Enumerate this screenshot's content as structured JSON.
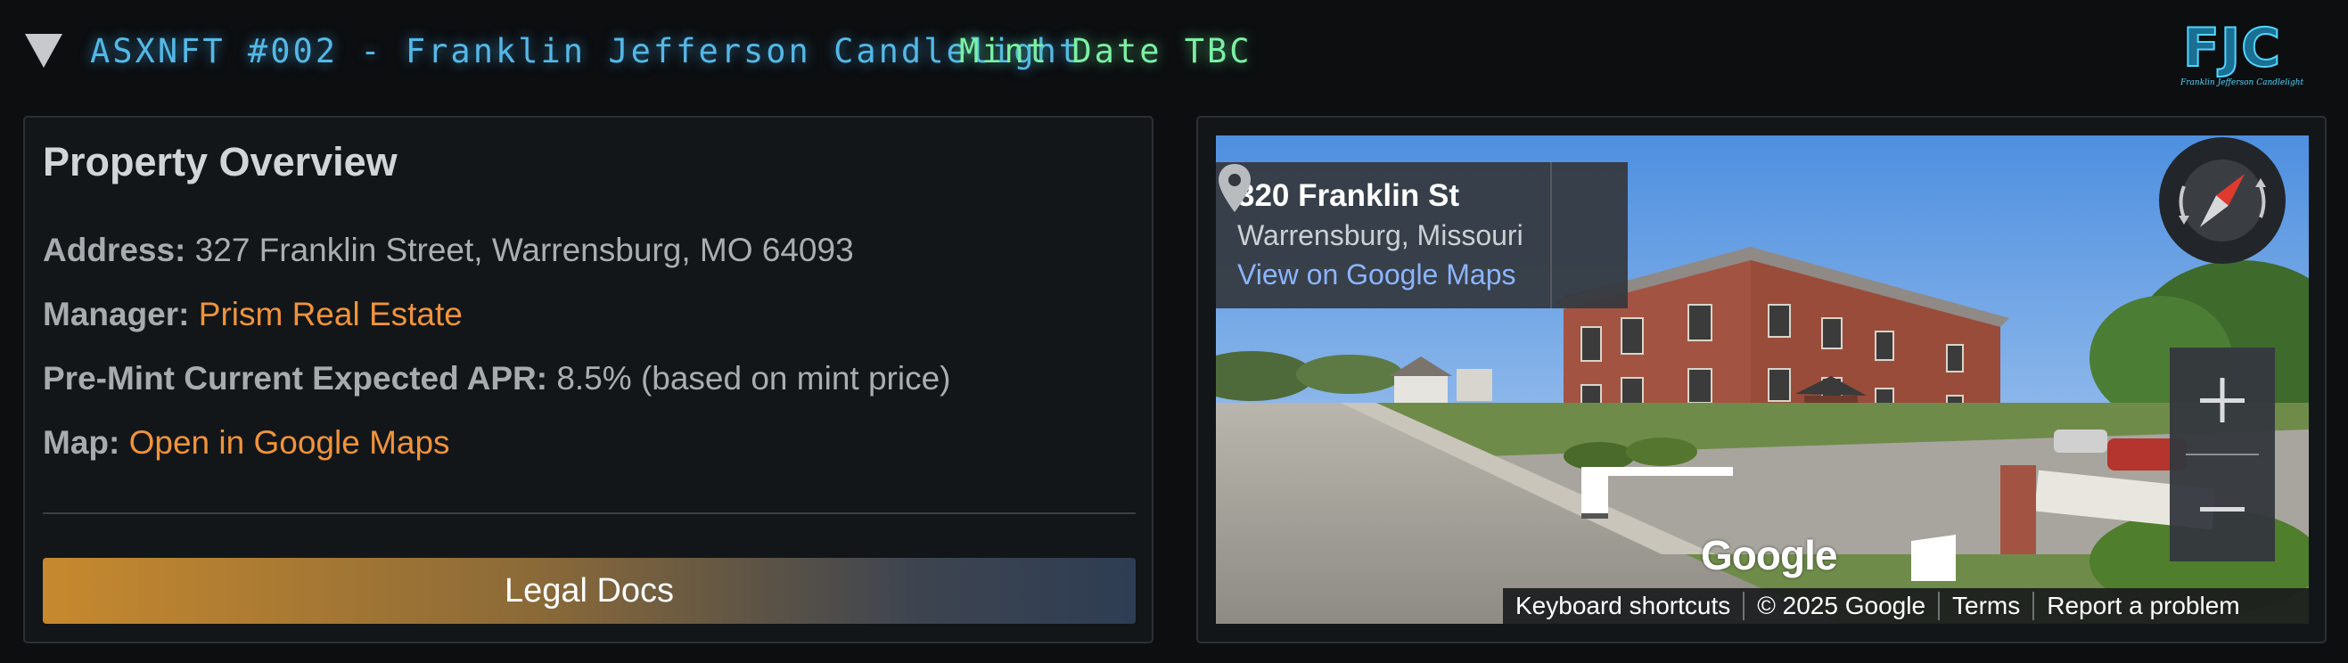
{
  "header": {
    "title": "ASXNFT #002 - Franklin Jefferson Candlelight",
    "mint_date": "Mint Date TBC",
    "logo_text": "FJC",
    "logo_subtitle": "Franklin Jefferson Candlelight"
  },
  "overview": {
    "title": "Property Overview",
    "address_label": "Address:",
    "address_value": "327 Franklin Street, Warrensburg, MO 64093",
    "manager_label": "Manager:",
    "manager_value": "Prism Real Estate",
    "apr_label": "Pre-Mint Current Expected APR:",
    "apr_value": "8.5% (based on mint price)",
    "map_label": "Map:",
    "map_link": "Open in Google Maps",
    "legal_button": "Legal Docs"
  },
  "map": {
    "street": "320 Franklin St",
    "city": "Warrensburg, Missouri",
    "view_link": "View on Google Maps",
    "google_logo": "Google",
    "footer": {
      "shortcuts": "Keyboard shortcuts",
      "copyright": "© 2025 Google",
      "terms": "Terms",
      "report": "Report a problem"
    }
  },
  "icons": [
    "collapse-triangle-icon",
    "map-pin-icon",
    "compass-icon",
    "zoom-in-icon",
    "zoom-out-icon"
  ],
  "colors": {
    "title_glow": "#54b8e6",
    "mint_date": "#7cf0a4",
    "link_orange": "#f0933a",
    "legal_gradient_start": "#c7892e",
    "legal_gradient_end": "#2e3d53",
    "panel_bg": "#121619",
    "page_bg": "#0c0e10"
  }
}
